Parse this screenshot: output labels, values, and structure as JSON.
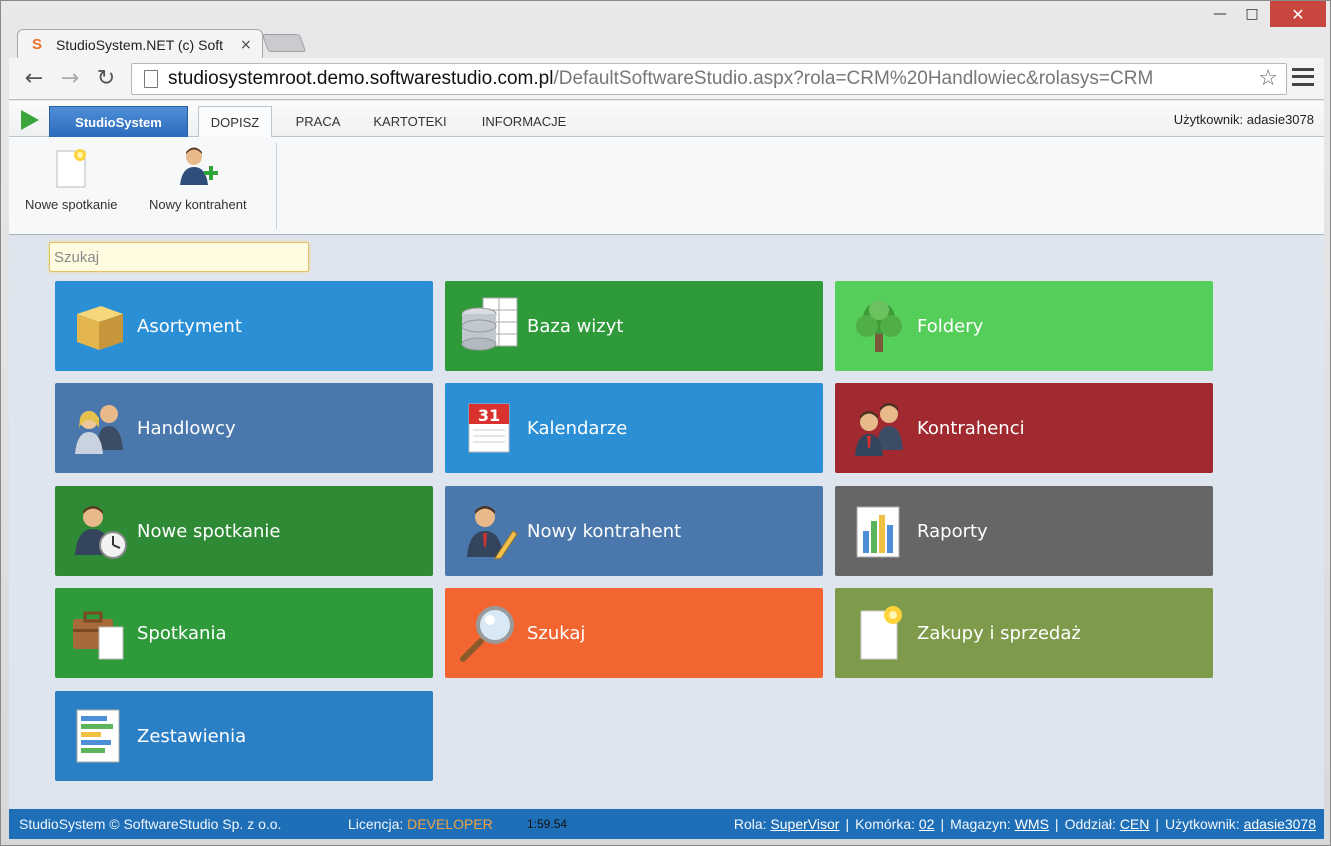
{
  "browser": {
    "tab_title": "StudioSystem.NET (c) Soft",
    "tab_close": "×",
    "favicon": "S",
    "url_host": "studiosystemroot.demo.softwarestudio.com.pl",
    "url_path": "/DefaultSoftwareStudio.aspx?rola=CRM%20Handlowiec&rolasys=CRM"
  },
  "ribbon": {
    "app_menu": "StudioSystem",
    "tabs": [
      {
        "label": "DOPISZ",
        "active": true
      },
      {
        "label": "PRACA",
        "active": false
      },
      {
        "label": "KARTOTEKI",
        "active": false
      },
      {
        "label": "INFORMACJE",
        "active": false
      }
    ],
    "user": "Użytkownik: adasie3078",
    "buttons": [
      {
        "label": "Nowe spotkanie",
        "icon": "new-document-icon"
      },
      {
        "label": "Nowy kontrahent",
        "icon": "add-user-icon"
      }
    ]
  },
  "search": {
    "placeholder": "Szukaj"
  },
  "tiles": [
    {
      "label": "Asortyment",
      "icon": "box-icon",
      "color": "#2b8fd6"
    },
    {
      "label": "Baza wizyt",
      "icon": "database-icon",
      "color": "#2e9a3a"
    },
    {
      "label": "Foldery",
      "icon": "tree-icon",
      "color": "#55cf5a"
    },
    {
      "label": "Handlowcy",
      "icon": "users-icon",
      "color": "#4a78ad"
    },
    {
      "label": "Kalendarze",
      "icon": "calendar-icon",
      "color": "#2b8fd6"
    },
    {
      "label": "Kontrahenci",
      "icon": "contacts-icon",
      "color": "#a02a2f"
    },
    {
      "label": "Nowe spotkanie",
      "icon": "user-clock-icon",
      "color": "#2e8a35"
    },
    {
      "label": "Nowy kontrahent",
      "icon": "user-edit-icon",
      "color": "#4a78ad"
    },
    {
      "label": "Raporty",
      "icon": "report-icon",
      "color": "#666666"
    },
    {
      "label": "Spotkania",
      "icon": "briefcase-icon",
      "color": "#2e9a3a"
    },
    {
      "label": "Szukaj",
      "icon": "magnifier-icon",
      "color": "#f26430"
    },
    {
      "label": "Zakupy i sprzedaż",
      "icon": "document-icon",
      "color": "#7d9b4a"
    },
    {
      "label": "Zestawienia",
      "icon": "list-icon",
      "color": "#2b7fc4"
    }
  ],
  "calendar_day": "31",
  "status": {
    "copyright": "StudioSystem © SoftwareStudio Sp. z o.o.",
    "license_label": "Licencja:",
    "license_value": "DEVELOPER",
    "time": "1:59.54",
    "role_label": "Rola:",
    "role_value": "SuperVisor",
    "cell_label": "Komórka:",
    "cell_value": "02",
    "warehouse_label": "Magazyn:",
    "warehouse_value": "WMS",
    "branch_label": "Oddział:",
    "branch_value": "CEN",
    "user_label": "Użytkownik:",
    "user_value": "adasie3078"
  }
}
